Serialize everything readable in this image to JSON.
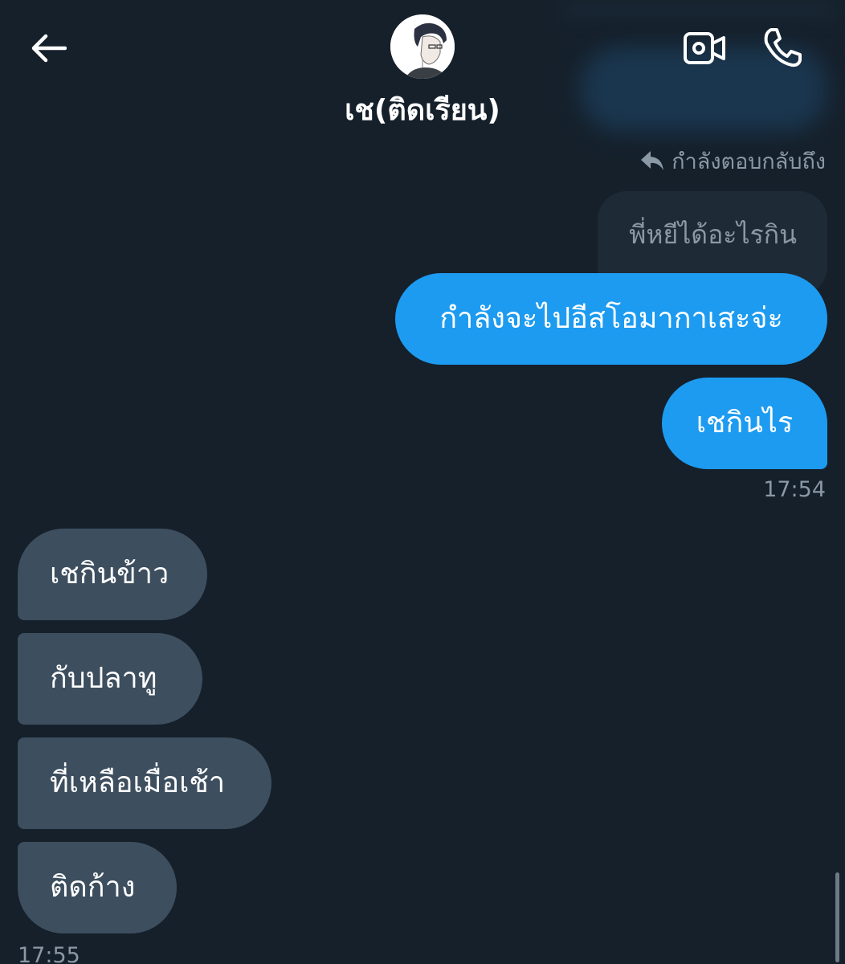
{
  "header": {
    "contact_name": "เช(ติดเรียน)",
    "back_icon": "arrow-left-icon",
    "video_icon": "video-camera-icon",
    "call_icon": "phone-icon"
  },
  "reply": {
    "context_label": "กำลังตอบกลับถึง",
    "quoted_text": "พี่หยีได้อะไรกิน"
  },
  "messages": {
    "outgoing": [
      {
        "text": "กำลังจะไปอีสโอมากาเสะจ่ะ"
      },
      {
        "text": "เชกินไร"
      }
    ],
    "outgoing_time": "17:54",
    "incoming": [
      {
        "text": "เชกินข้าว"
      },
      {
        "text": "กับปลาทู"
      },
      {
        "text": "ที่เหลือเมื่อเช้า"
      },
      {
        "text": "ติดก้าง"
      }
    ],
    "incoming_time": "17:55"
  },
  "colors": {
    "background": "#15202b",
    "outgoing_bubble": "#1d9bf0",
    "incoming_bubble": "#3d4e5e",
    "muted_text": "#8b98a5"
  }
}
